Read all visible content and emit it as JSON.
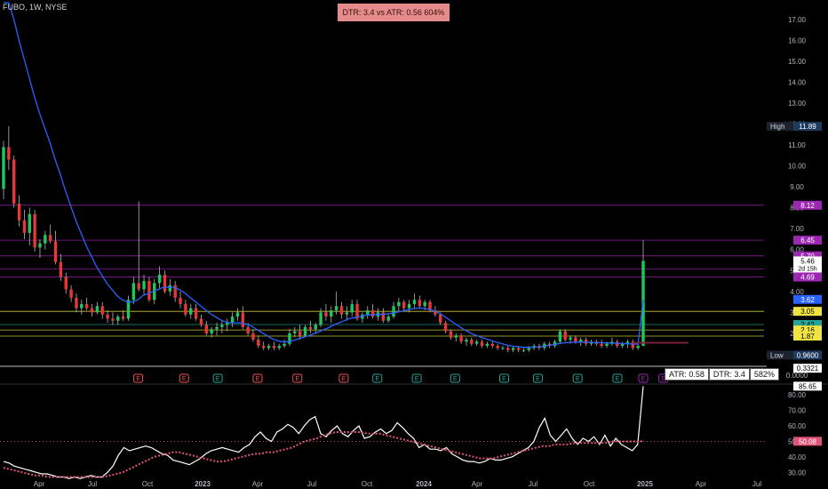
{
  "header": {
    "symbol": "FUBO, 1W, NYSE"
  },
  "banner": {
    "text": "DTR: 3.4 vs ATR: 0.56 604%",
    "color": "#e58b8b"
  },
  "atr_table": {
    "atr": "ATR: 0.58",
    "dtr": "DTR: 3.4",
    "pct": "582%"
  },
  "colors": {
    "up": "#26a69a",
    "upBody": "#22c55e",
    "down": "#ef5350",
    "downBody": "#e53935",
    "ma": "#2962ff",
    "rsi": "#ffffff",
    "rsiMa": "#e05577"
  },
  "chart_data": [
    {
      "type": "candlestick",
      "title": "FUBO, 1W, NYSE",
      "y_axis_labels": [
        "17.00",
        "16.00",
        "15.00",
        "14.00",
        "13.00",
        "12.00",
        "11.00",
        "10.00",
        "9.00",
        "8.00",
        "7.00",
        "6.00",
        "5.00",
        "4.00",
        "3.00",
        "2.00",
        "1.00",
        "0.0000"
      ],
      "ylim": [
        0,
        17.5
      ],
      "price_labels": [
        {
          "text": "High",
          "value": "11.89",
          "color": "#1e3a5f",
          "y": 11.89
        },
        {
          "text": "",
          "value": "8.12",
          "color": "#9c27b0",
          "y": 8.12
        },
        {
          "text": "",
          "value": "6.45",
          "color": "#9c27b0",
          "y": 6.45
        },
        {
          "text": "",
          "value": "5.70",
          "color": "#9c27b0",
          "y": 5.7
        },
        {
          "text": "",
          "value": "5.07",
          "color": "#9c27b0",
          "y": 5.07
        },
        {
          "text": "",
          "value": "4.69",
          "color": "#9c27b0",
          "y": 4.69
        },
        {
          "text": "",
          "value": "3.62",
          "color": "#2962ff",
          "y": 3.62
        },
        {
          "text": "",
          "value": "3.05",
          "color": "#f0e442",
          "y": 3.05
        },
        {
          "text": "",
          "value": "2.42",
          "color": "#26a69a",
          "y": 2.42
        },
        {
          "text": "",
          "value": "2.16",
          "color": "#f0e442",
          "y": 2.16
        },
        {
          "text": "",
          "value": "1.87",
          "color": "#f0e442",
          "y": 1.87
        },
        {
          "text": "Low",
          "value": "0.9600",
          "color": "#1e3a5f",
          "y": 0.96
        },
        {
          "text": "",
          "value": "0.3321",
          "color": "#ffffff",
          "y": 0.3321
        }
      ],
      "current_price": {
        "value": "5.46",
        "countdown": "2d 15h",
        "y": 5.46
      },
      "levels": [
        {
          "y": 8.12,
          "color": "#9c27b0"
        },
        {
          "y": 6.45,
          "color": "#9c27b0"
        },
        {
          "y": 5.7,
          "color": "#9c27b0"
        },
        {
          "y": 5.07,
          "color": "#9c27b0"
        },
        {
          "y": 4.69,
          "color": "#9c27b0"
        },
        {
          "y": 3.05,
          "color": "#f0e442"
        },
        {
          "y": 2.42,
          "color": "#26a69a"
        },
        {
          "y": 2.16,
          "color": "#f0e442"
        },
        {
          "y": 1.87,
          "color": "#f0e442"
        }
      ],
      "x_labels": [
        "Apr",
        "Jul",
        "Oct",
        "2023",
        "Apr",
        "Jul",
        "Oct",
        "2024",
        "Apr",
        "Jul",
        "Oct",
        "2025",
        "Apr",
        "Jul"
      ],
      "earnings_markers": [
        {
          "x": "2021-11-08",
          "label": "E",
          "color": "#ef5350"
        },
        {
          "x": "2022-02-21",
          "label": "E",
          "color": "#ef5350"
        },
        {
          "x": "2022-05-09",
          "label": "E",
          "color": "#26a69a"
        },
        {
          "x": "2022-08-08",
          "label": "E",
          "color": "#ef5350"
        },
        {
          "x": "2022-11-07",
          "label": "E",
          "color": "#ef5350"
        },
        {
          "x": "2023-02-21",
          "label": "E",
          "color": "#ef5350"
        },
        {
          "x": "2023-05-09",
          "label": "E",
          "color": "#26a69a"
        },
        {
          "x": "2023-08-07",
          "label": "E",
          "color": "#26a69a"
        },
        {
          "x": "2023-11-03",
          "label": "E",
          "color": "#26a69a"
        },
        {
          "x": "2024-02-23",
          "label": "E",
          "color": "#26a69a"
        },
        {
          "x": "2024-05-10",
          "label": "E",
          "color": "#26a69a"
        },
        {
          "x": "2024-08-09",
          "label": "E",
          "color": "#26a69a"
        },
        {
          "x": "2024-11-08",
          "label": "E",
          "color": "#26a69a"
        },
        {
          "x": "2025-01-06",
          "label": "E",
          "color": "#9c27b0"
        },
        {
          "x": "2025-02-21",
          "label": "E",
          "color": "#9c27b0"
        }
      ],
      "ohlc_weekly": [
        [
          8.9,
          11.2,
          8.4,
          10.9
        ],
        [
          10.9,
          11.9,
          9.8,
          10.3
        ],
        [
          10.3,
          10.5,
          8.0,
          8.2
        ],
        [
          8.2,
          8.6,
          7.1,
          7.4
        ],
        [
          7.4,
          7.9,
          6.5,
          6.8
        ],
        [
          6.8,
          8.0,
          6.2,
          7.7
        ],
        [
          7.7,
          7.9,
          5.9,
          6.1
        ],
        [
          6.1,
          6.5,
          5.6,
          6.3
        ],
        [
          6.3,
          6.9,
          6.0,
          6.7
        ],
        [
          6.7,
          7.2,
          6.3,
          6.4
        ],
        [
          6.4,
          6.9,
          5.3,
          5.4
        ],
        [
          5.4,
          5.8,
          4.5,
          4.7
        ],
        [
          4.7,
          4.9,
          3.9,
          4.1
        ],
        [
          4.1,
          4.3,
          3.5,
          3.7
        ],
        [
          3.7,
          3.9,
          3.0,
          3.2
        ],
        [
          3.2,
          3.6,
          2.9,
          3.4
        ],
        [
          3.4,
          3.7,
          3.1,
          3.2
        ],
        [
          3.2,
          3.4,
          2.8,
          3.0
        ],
        [
          3.0,
          3.5,
          2.9,
          3.3
        ],
        [
          3.3,
          3.5,
          2.7,
          2.9
        ],
        [
          2.9,
          3.1,
          2.5,
          2.7
        ],
        [
          2.7,
          3.0,
          2.4,
          2.6
        ],
        [
          2.6,
          2.9,
          2.4,
          2.8
        ],
        [
          2.8,
          3.1,
          2.6,
          2.7
        ],
        [
          2.7,
          3.8,
          2.6,
          3.6
        ],
        [
          3.6,
          4.7,
          3.4,
          4.4
        ],
        [
          4.4,
          8.3,
          4.0,
          4.1
        ],
        [
          4.1,
          4.8,
          3.8,
          4.5
        ],
        [
          4.5,
          4.7,
          3.5,
          3.6
        ],
        [
          3.6,
          4.6,
          3.4,
          4.4
        ],
        [
          4.4,
          5.2,
          4.1,
          4.8
        ],
        [
          4.8,
          5.0,
          3.9,
          4.0
        ],
        [
          4.0,
          4.6,
          3.8,
          4.3
        ],
        [
          4.3,
          4.5,
          3.5,
          3.7
        ],
        [
          3.7,
          4.0,
          3.2,
          3.4
        ],
        [
          3.4,
          3.6,
          2.8,
          2.9
        ],
        [
          2.9,
          3.4,
          2.7,
          3.2
        ],
        [
          3.2,
          3.4,
          2.6,
          2.7
        ],
        [
          2.7,
          2.9,
          2.3,
          2.4
        ],
        [
          2.4,
          2.6,
          1.9,
          2.0
        ],
        [
          2.0,
          2.3,
          1.8,
          2.2
        ],
        [
          2.2,
          2.5,
          1.9,
          2.3
        ],
        [
          2.3,
          2.6,
          2.0,
          2.4
        ],
        [
          2.4,
          2.7,
          2.1,
          2.5
        ],
        [
          2.5,
          3.0,
          2.3,
          2.8
        ],
        [
          2.8,
          3.2,
          2.6,
          3.0
        ],
        [
          3.0,
          3.3,
          2.2,
          2.3
        ],
        [
          2.3,
          2.5,
          1.9,
          2.0
        ],
        [
          2.0,
          2.2,
          1.6,
          1.7
        ],
        [
          1.7,
          1.9,
          1.3,
          1.4
        ],
        [
          1.4,
          1.6,
          1.2,
          1.3
        ],
        [
          1.3,
          1.5,
          1.2,
          1.4
        ],
        [
          1.4,
          1.6,
          1.2,
          1.3
        ],
        [
          1.3,
          1.5,
          1.2,
          1.4
        ],
        [
          1.4,
          1.7,
          1.3,
          1.5
        ],
        [
          1.5,
          2.2,
          1.4,
          2.0
        ],
        [
          2.0,
          2.3,
          1.8,
          2.1
        ],
        [
          2.1,
          2.4,
          1.7,
          1.9
        ],
        [
          1.9,
          2.4,
          1.8,
          2.3
        ],
        [
          2.3,
          2.6,
          2.0,
          2.2
        ],
        [
          2.2,
          2.5,
          2.0,
          2.4
        ],
        [
          2.4,
          3.2,
          2.3,
          3.0
        ],
        [
          3.0,
          3.4,
          2.6,
          2.8
        ],
        [
          2.8,
          3.3,
          2.5,
          3.1
        ],
        [
          3.1,
          4.0,
          2.9,
          3.3
        ],
        [
          3.3,
          3.5,
          2.7,
          2.9
        ],
        [
          2.9,
          3.3,
          2.6,
          3.0
        ],
        [
          3.0,
          3.6,
          2.8,
          3.4
        ],
        [
          3.4,
          3.6,
          2.6,
          2.7
        ],
        [
          2.7,
          3.0,
          2.5,
          2.9
        ],
        [
          2.9,
          3.3,
          2.7,
          3.1
        ],
        [
          3.1,
          3.4,
          2.7,
          2.8
        ],
        [
          2.8,
          3.2,
          2.6,
          3.0
        ],
        [
          3.0,
          3.2,
          2.5,
          2.6
        ],
        [
          2.6,
          2.9,
          2.5,
          2.8
        ],
        [
          2.8,
          3.5,
          2.7,
          3.3
        ],
        [
          3.3,
          3.7,
          3.0,
          3.5
        ],
        [
          3.5,
          3.6,
          3.1,
          3.2
        ],
        [
          3.2,
          3.6,
          3.0,
          3.4
        ],
        [
          3.4,
          3.9,
          3.2,
          3.6
        ],
        [
          3.6,
          3.8,
          3.2,
          3.3
        ],
        [
          3.3,
          3.6,
          3.1,
          3.5
        ],
        [
          3.5,
          3.6,
          3.0,
          3.1
        ],
        [
          3.1,
          3.3,
          2.8,
          2.9
        ],
        [
          2.9,
          3.0,
          2.4,
          2.5
        ],
        [
          2.5,
          2.6,
          2.0,
          2.1
        ],
        [
          2.1,
          2.2,
          1.7,
          1.8
        ],
        [
          1.8,
          2.0,
          1.6,
          1.9
        ],
        [
          1.9,
          2.0,
          1.5,
          1.6
        ],
        [
          1.6,
          1.8,
          1.4,
          1.7
        ],
        [
          1.7,
          1.8,
          1.4,
          1.5
        ],
        [
          1.5,
          1.7,
          1.4,
          1.6
        ],
        [
          1.6,
          1.7,
          1.3,
          1.4
        ],
        [
          1.4,
          1.6,
          1.3,
          1.5
        ],
        [
          1.5,
          1.6,
          1.3,
          1.4
        ],
        [
          1.4,
          1.5,
          1.2,
          1.3
        ],
        [
          1.3,
          1.4,
          1.2,
          1.3
        ],
        [
          1.3,
          1.4,
          1.1,
          1.2
        ],
        [
          1.2,
          1.4,
          1.1,
          1.3
        ],
        [
          1.3,
          1.4,
          1.1,
          1.2
        ],
        [
          1.2,
          1.3,
          1.1,
          1.2
        ],
        [
          1.2,
          1.4,
          1.1,
          1.3
        ],
        [
          1.3,
          1.5,
          1.2,
          1.4
        ],
        [
          1.4,
          1.5,
          1.2,
          1.3
        ],
        [
          1.3,
          1.6,
          1.2,
          1.5
        ],
        [
          1.5,
          1.6,
          1.3,
          1.4
        ],
        [
          1.4,
          1.7,
          1.3,
          1.6
        ],
        [
          1.6,
          2.2,
          1.5,
          2.1
        ],
        [
          2.1,
          2.2,
          1.6,
          1.7
        ],
        [
          1.7,
          1.9,
          1.5,
          1.8
        ],
        [
          1.8,
          1.9,
          1.5,
          1.6
        ],
        [
          1.6,
          1.8,
          1.4,
          1.7
        ],
        [
          1.7,
          1.8,
          1.4,
          1.5
        ],
        [
          1.5,
          1.7,
          1.4,
          1.6
        ],
        [
          1.6,
          1.7,
          1.4,
          1.5
        ],
        [
          1.5,
          1.7,
          1.3,
          1.4
        ],
        [
          1.4,
          1.6,
          1.3,
          1.5
        ],
        [
          1.5,
          1.8,
          1.4,
          1.6
        ],
        [
          1.6,
          1.7,
          1.3,
          1.4
        ],
        [
          1.4,
          1.6,
          1.3,
          1.5
        ],
        [
          1.5,
          1.7,
          1.3,
          1.6
        ],
        [
          1.6,
          1.7,
          1.2,
          1.3
        ],
        [
          1.3,
          1.5,
          1.2,
          1.4
        ],
        [
          1.4,
          6.45,
          1.4,
          5.46
        ]
      ],
      "ma_series": [
        18.5,
        17.9,
        17.0,
        16.0,
        15.1,
        14.2,
        13.3,
        12.5,
        11.8,
        11.1,
        10.3,
        9.6,
        8.8,
        8.1,
        7.4,
        6.8,
        6.2,
        5.7,
        5.2,
        4.8,
        4.4,
        4.1,
        3.8,
        3.6,
        3.5,
        3.5,
        3.6,
        3.8,
        3.9,
        4.0,
        4.1,
        4.2,
        4.2,
        4.2,
        4.1,
        3.95,
        3.75,
        3.55,
        3.35,
        3.15,
        2.95,
        2.8,
        2.65,
        2.55,
        2.5,
        2.5,
        2.5,
        2.45,
        2.35,
        2.2,
        2.05,
        1.9,
        1.75,
        1.65,
        1.6,
        1.6,
        1.65,
        1.72,
        1.8,
        1.88,
        1.96,
        2.06,
        2.17,
        2.27,
        2.4,
        2.5,
        2.6,
        2.7,
        2.75,
        2.8,
        2.85,
        2.88,
        2.9,
        2.9,
        2.92,
        2.95,
        3.0,
        3.05,
        3.1,
        3.15,
        3.2,
        3.2,
        3.18,
        3.12,
        3.02,
        2.88,
        2.72,
        2.55,
        2.38,
        2.22,
        2.08,
        1.96,
        1.86,
        1.78,
        1.7,
        1.62,
        1.55,
        1.48,
        1.42,
        1.38,
        1.35,
        1.33,
        1.33,
        1.34,
        1.36,
        1.4,
        1.44,
        1.48,
        1.52,
        1.55,
        1.57,
        1.58,
        1.58,
        1.58,
        1.57,
        1.56,
        1.55,
        1.54,
        1.53,
        1.52,
        1.51,
        1.5,
        1.49,
        1.48,
        3.62
      ]
    },
    {
      "type": "line",
      "title": "",
      "y_axis_labels": [
        "80.00",
        "70.00",
        "60.00",
        "50.00",
        "40.00",
        "30.00"
      ],
      "ylim": [
        25,
        85
      ],
      "labels": [
        {
          "value": "85.65",
          "y": 85.65,
          "color": "#ffffff"
        },
        {
          "value": "50.08",
          "y": 50.08,
          "color": "#e05577"
        }
      ],
      "midline": 50,
      "rsi_series": [
        37,
        36,
        34,
        33,
        32,
        31,
        30,
        29,
        29,
        28,
        27,
        27,
        26,
        27,
        26,
        27,
        28,
        27,
        27,
        30,
        34,
        41,
        46,
        44,
        45,
        46,
        47,
        46,
        44,
        42,
        41,
        38,
        37,
        36,
        35,
        37,
        39,
        42,
        44,
        45,
        46,
        45,
        44,
        43,
        46,
        48,
        53,
        56,
        52,
        50,
        56,
        58,
        61,
        59,
        55,
        60,
        64,
        66,
        55,
        53,
        57,
        60,
        55,
        53,
        57,
        60,
        52,
        53,
        56,
        58,
        55,
        57,
        62,
        59,
        55,
        52,
        46,
        48,
        45,
        45,
        44,
        46,
        42,
        40,
        38,
        37,
        37,
        36,
        37,
        39,
        38,
        38,
        39,
        40,
        42,
        44,
        46,
        50,
        59,
        65,
        54,
        50,
        54,
        58,
        52,
        48,
        52,
        50,
        53,
        48,
        54,
        47,
        52,
        48,
        46,
        44,
        48,
        85.65
      ],
      "rsi_ma_series": [
        33,
        32,
        31,
        30,
        29,
        28,
        28,
        27,
        27,
        27,
        27,
        27,
        27,
        27,
        27,
        27,
        27,
        28,
        29,
        30,
        32,
        34,
        36,
        38,
        40,
        41,
        42,
        43,
        43,
        42,
        41,
        40,
        39,
        38,
        37,
        37,
        38,
        39,
        40,
        41,
        42,
        42,
        43,
        43,
        44,
        45,
        46,
        48,
        50,
        51,
        52,
        54,
        55,
        56,
        56,
        56,
        56,
        56,
        55,
        55,
        55,
        54,
        53,
        52,
        51,
        50,
        49,
        48,
        47,
        46,
        45,
        44,
        43,
        42,
        41,
        40,
        39,
        39,
        39,
        40,
        41,
        42,
        43,
        44,
        45,
        46,
        47,
        47,
        48,
        48,
        48,
        49,
        49,
        49,
        49,
        49,
        49,
        50,
        50,
        50,
        50,
        50,
        50.08
      ]
    }
  ]
}
